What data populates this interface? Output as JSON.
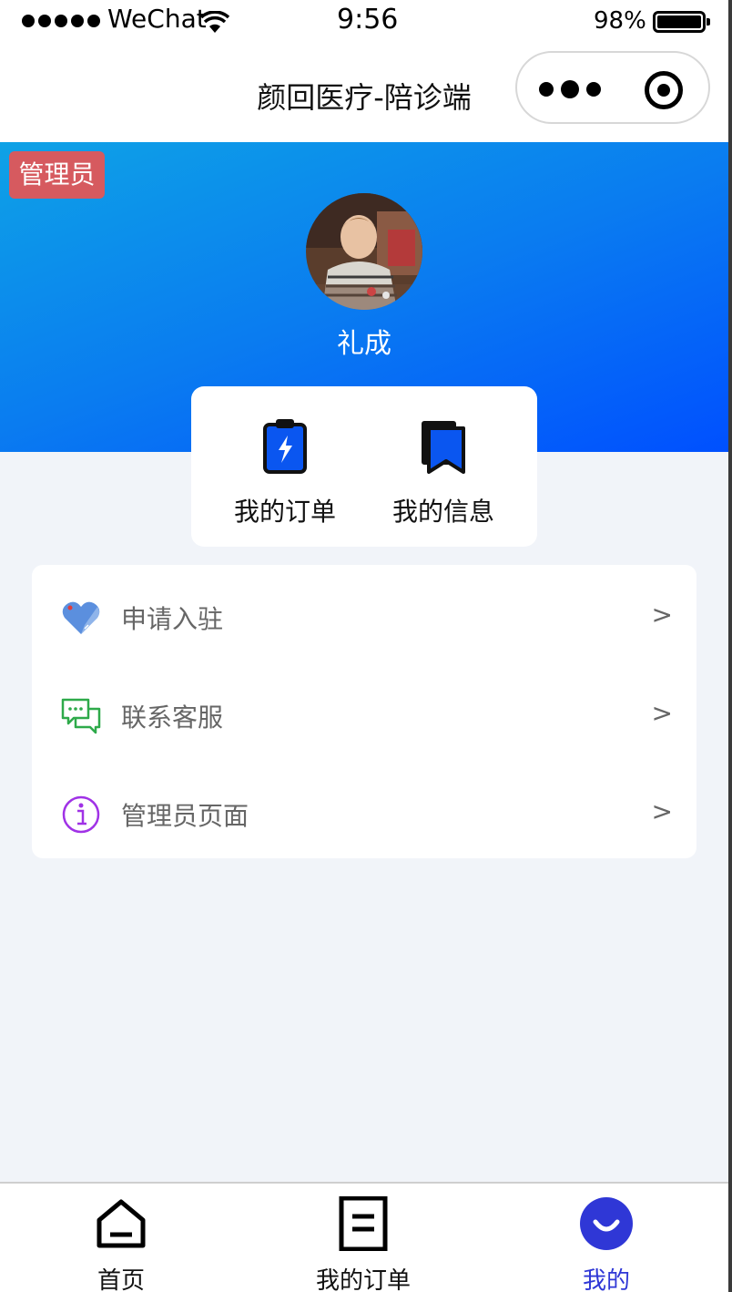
{
  "status_bar": {
    "carrier": "WeChat",
    "time": "9:56",
    "battery_percent": "98%",
    "battery_level": 0.98
  },
  "nav": {
    "title": "颜回医疗-陪诊端"
  },
  "profile": {
    "badge": "管理员",
    "name": "礼成"
  },
  "quick_actions": [
    {
      "label": "我的订单",
      "icon": "clipboard-bolt-icon"
    },
    {
      "label": "我的信息",
      "icon": "bookmark-stack-icon"
    }
  ],
  "menu": {
    "items": [
      {
        "label": "申请入驻",
        "icon": "heart-tag-icon",
        "arrow": ">"
      },
      {
        "label": "联系客服",
        "icon": "chat-bubbles-icon",
        "arrow": ">"
      },
      {
        "label": "管理员页面",
        "icon": "info-icon",
        "arrow": ">"
      }
    ]
  },
  "tab_bar": {
    "items": [
      {
        "label": "首页",
        "icon": "home-icon"
      },
      {
        "label": "我的订单",
        "icon": "document-icon"
      },
      {
        "label": "我的",
        "icon": "smile-icon",
        "active": true
      }
    ]
  },
  "colors": {
    "hero_gradient_start": "#0ea2e6",
    "hero_gradient_end": "#0050ff",
    "badge": "#d65a5f",
    "active_tab": "#2f37d6",
    "page_bg": "#f1f4f9"
  }
}
